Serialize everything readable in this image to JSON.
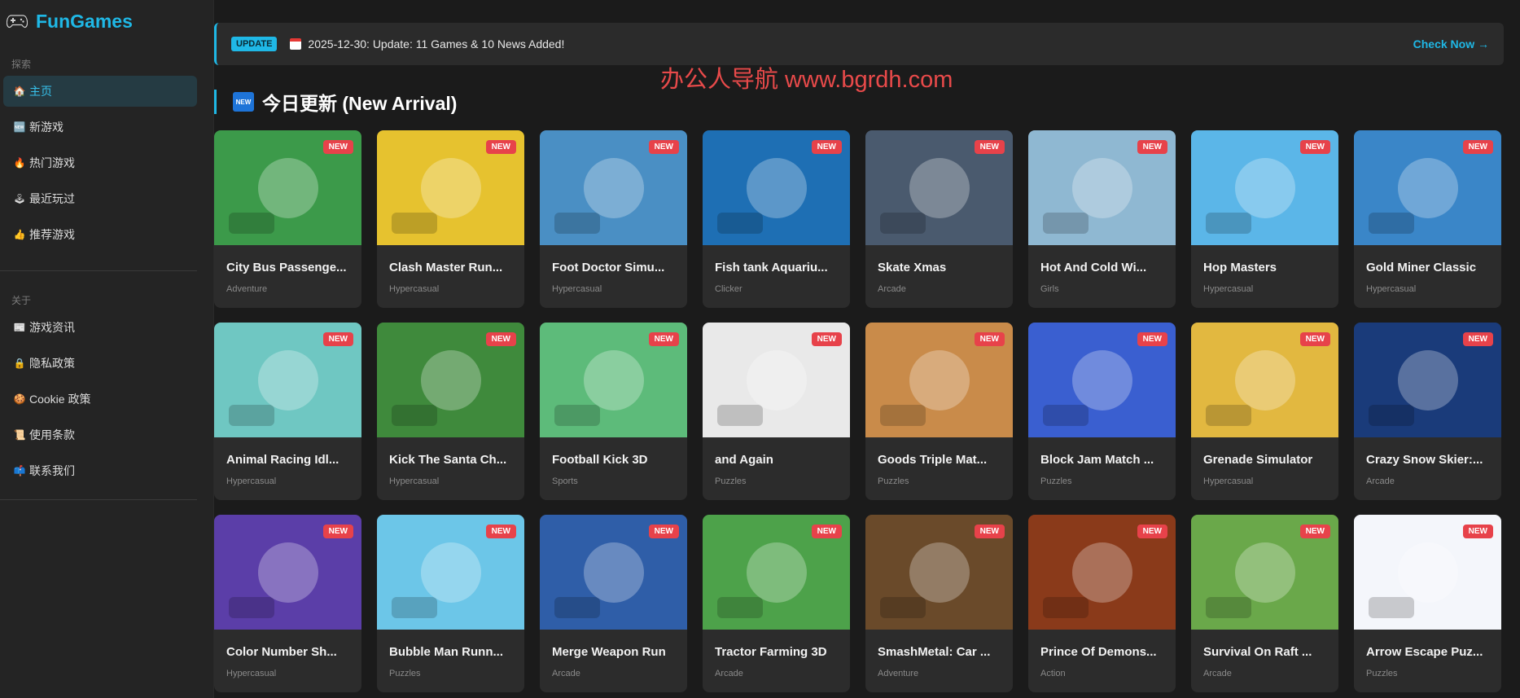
{
  "brand": {
    "name": "FunGames",
    "icon": "gamepad-icon"
  },
  "sidebar": {
    "section1_label": "探索",
    "nav": [
      {
        "label": "主页",
        "icon": "home-icon",
        "glyph": "🏠",
        "active": true
      },
      {
        "label": "新游戏",
        "icon": "new-icon",
        "glyph": "🆕",
        "active": false
      },
      {
        "label": "热门游戏",
        "icon": "fire-icon",
        "glyph": "🔥",
        "active": false
      },
      {
        "label": "最近玩过",
        "icon": "joystick-icon",
        "glyph": "🕹",
        "active": false
      },
      {
        "label": "推荐游戏",
        "icon": "thumbs-up-icon",
        "glyph": "👍",
        "active": false
      }
    ],
    "section2_label": "关于",
    "about": [
      {
        "label": "游戏资讯",
        "icon": "news-icon",
        "glyph": "📰"
      },
      {
        "label": "隐私政策",
        "icon": "lock-icon",
        "glyph": "🔒"
      },
      {
        "label": "Cookie 政策",
        "icon": "cookie-icon",
        "glyph": "🍪"
      },
      {
        "label": "使用条款",
        "icon": "scroll-icon",
        "glyph": "📜"
      },
      {
        "label": "联系我们",
        "icon": "mailbox-icon",
        "glyph": "📫"
      }
    ]
  },
  "update": {
    "badge": "UPDATE",
    "text": "2025-12-30: Update: 11 Games & 10 News Added!",
    "link": "Check Now →"
  },
  "watermark": "办公人导航  www.bgrdh.com",
  "section": {
    "icon_text": "NEW",
    "title": "今日更新 (New Arrival)"
  },
  "new_badge": "NEW",
  "colors": {
    "accent": "#1fb8e6",
    "badge_red": "#e7424a",
    "card_bg": "#2c2c2c",
    "page_bg": "#1b1b1b"
  },
  "games": [
    {
      "title": "City Bus Passenge...",
      "category": "Adventure",
      "color": "#3c9a4a"
    },
    {
      "title": "Clash Master Run...",
      "category": "Hypercasual",
      "color": "#e6c22f"
    },
    {
      "title": "Foot Doctor Simu...",
      "category": "Hypercasual",
      "color": "#4a8fc4"
    },
    {
      "title": "Fish tank Aquariu...",
      "category": "Clicker",
      "color": "#1e6fb4"
    },
    {
      "title": "Skate Xmas",
      "category": "Arcade",
      "color": "#4a5a6e"
    },
    {
      "title": "Hot And Cold Wi...",
      "category": "Girls",
      "color": "#8fb8d2"
    },
    {
      "title": "Hop Masters",
      "category": "Hypercasual",
      "color": "#5bb6e8"
    },
    {
      "title": "Gold Miner Classic",
      "category": "Hypercasual",
      "color": "#3a86c8"
    },
    {
      "title": "Animal Racing Idl...",
      "category": "Hypercasual",
      "color": "#6fc7c2"
    },
    {
      "title": "Kick The Santa Ch...",
      "category": "Hypercasual",
      "color": "#3f8a3c"
    },
    {
      "title": "Football Kick 3D",
      "category": "Sports",
      "color": "#5dbb7a"
    },
    {
      "title": "and Again",
      "category": "Puzzles",
      "color": "#e9e9e9"
    },
    {
      "title": "Goods Triple Mat...",
      "category": "Puzzles",
      "color": "#c98b4a"
    },
    {
      "title": "Block Jam Match ...",
      "category": "Puzzles",
      "color": "#3a5fd0"
    },
    {
      "title": "Grenade Simulator",
      "category": "Hypercasual",
      "color": "#e2b840"
    },
    {
      "title": "Crazy Snow Skier:...",
      "category": "Arcade",
      "color": "#1a3b7a"
    },
    {
      "title": "Color Number Sh...",
      "category": "Hypercasual",
      "color": "#5b3ea8"
    },
    {
      "title": "Bubble Man Runn...",
      "category": "Puzzles",
      "color": "#6cc6e8"
    },
    {
      "title": "Merge Weapon Run",
      "category": "Arcade",
      "color": "#2f5ea8"
    },
    {
      "title": "Tractor Farming 3D",
      "category": "Arcade",
      "color": "#4da24a"
    },
    {
      "title": "SmashMetal: Car ...",
      "category": "Adventure",
      "color": "#6a4a2a"
    },
    {
      "title": "Prince Of Demons...",
      "category": "Action",
      "color": "#8a3a1a"
    },
    {
      "title": "Survival On Raft ...",
      "category": "Arcade",
      "color": "#6aa84a"
    },
    {
      "title": "Arrow Escape Puz...",
      "category": "Puzzles",
      "color": "#f4f6fb"
    }
  ]
}
